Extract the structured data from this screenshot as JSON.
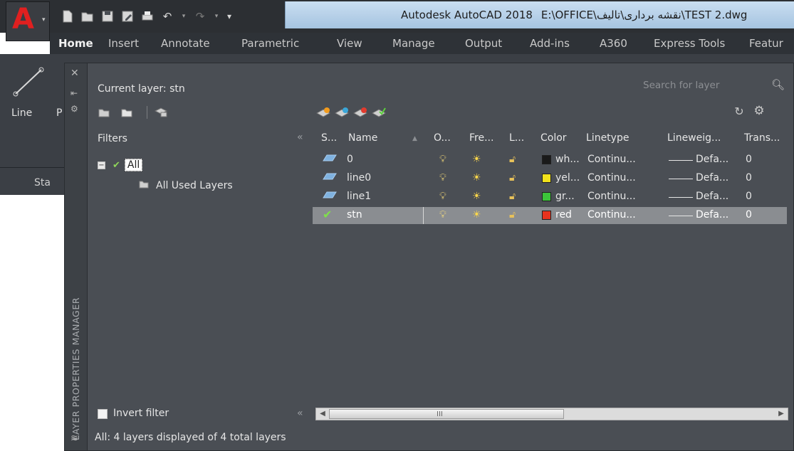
{
  "app": {
    "logo_letter": "A",
    "title_app": "Autodesk AutoCAD 2018",
    "title_path": "E:\\OFFICE\\نقشه برداری\\تالیف\\TEST 2.dwg"
  },
  "quick_access": {
    "icons": [
      "new-icon",
      "open-icon",
      "save-icon",
      "save-as-icon",
      "plot-icon",
      "undo-icon",
      "redo-icon",
      "customize-icon"
    ]
  },
  "ribbon": {
    "tabs": [
      "Home",
      "Insert",
      "Annotate",
      "Parametric",
      "View",
      "Manage",
      "Output",
      "Add-ins",
      "A360",
      "Express Tools",
      "Featur"
    ],
    "active_tab": "Home",
    "line_label": "Line",
    "p_label": "P",
    "start_tab": "Sta"
  },
  "palette": {
    "side_title": "LAYER PROPERTIES MANAGER",
    "current_layer": "Current layer: stn",
    "search_placeholder": "Search for layer",
    "filters_header": "Filters",
    "collapse_glyph": "«",
    "tree": {
      "all_label": "All",
      "used_label": "All Used Layers"
    },
    "invert_filter_label": "Invert filter",
    "status_text": "All: 4 layers displayed of 4 total layers"
  },
  "grid": {
    "columns": [
      "S...",
      "Name",
      "O...",
      "Fre...",
      "L...",
      "Color",
      "Linetype",
      "Lineweig...",
      "Trans..."
    ],
    "rows": [
      {
        "status": "layer",
        "name": "0",
        "color_name": "wh...",
        "color_hex": "#1a1a1a",
        "linetype": "Continu...",
        "lineweight": "Defa...",
        "transparency": "0",
        "selected": false
      },
      {
        "status": "layer",
        "name": "line0",
        "color_name": "yel...",
        "color_hex": "#f2e21b",
        "linetype": "Continu...",
        "lineweight": "Defa...",
        "transparency": "0",
        "selected": false
      },
      {
        "status": "layer",
        "name": "line1",
        "color_name": "gr...",
        "color_hex": "#3cc43a",
        "linetype": "Continu...",
        "lineweight": "Defa...",
        "transparency": "0",
        "selected": false
      },
      {
        "status": "current",
        "name": "stn",
        "color_name": "red",
        "color_hex": "#e8321e",
        "linetype": "Continu...",
        "lineweight": "Defa...",
        "transparency": "0",
        "selected": true
      }
    ]
  },
  "scrollbar": {
    "grip_glyph": "III"
  },
  "colors": {
    "palette_bg": "#4a4e54",
    "title_blue": "#b9d3ec",
    "selected_row": "#8a8d91"
  }
}
